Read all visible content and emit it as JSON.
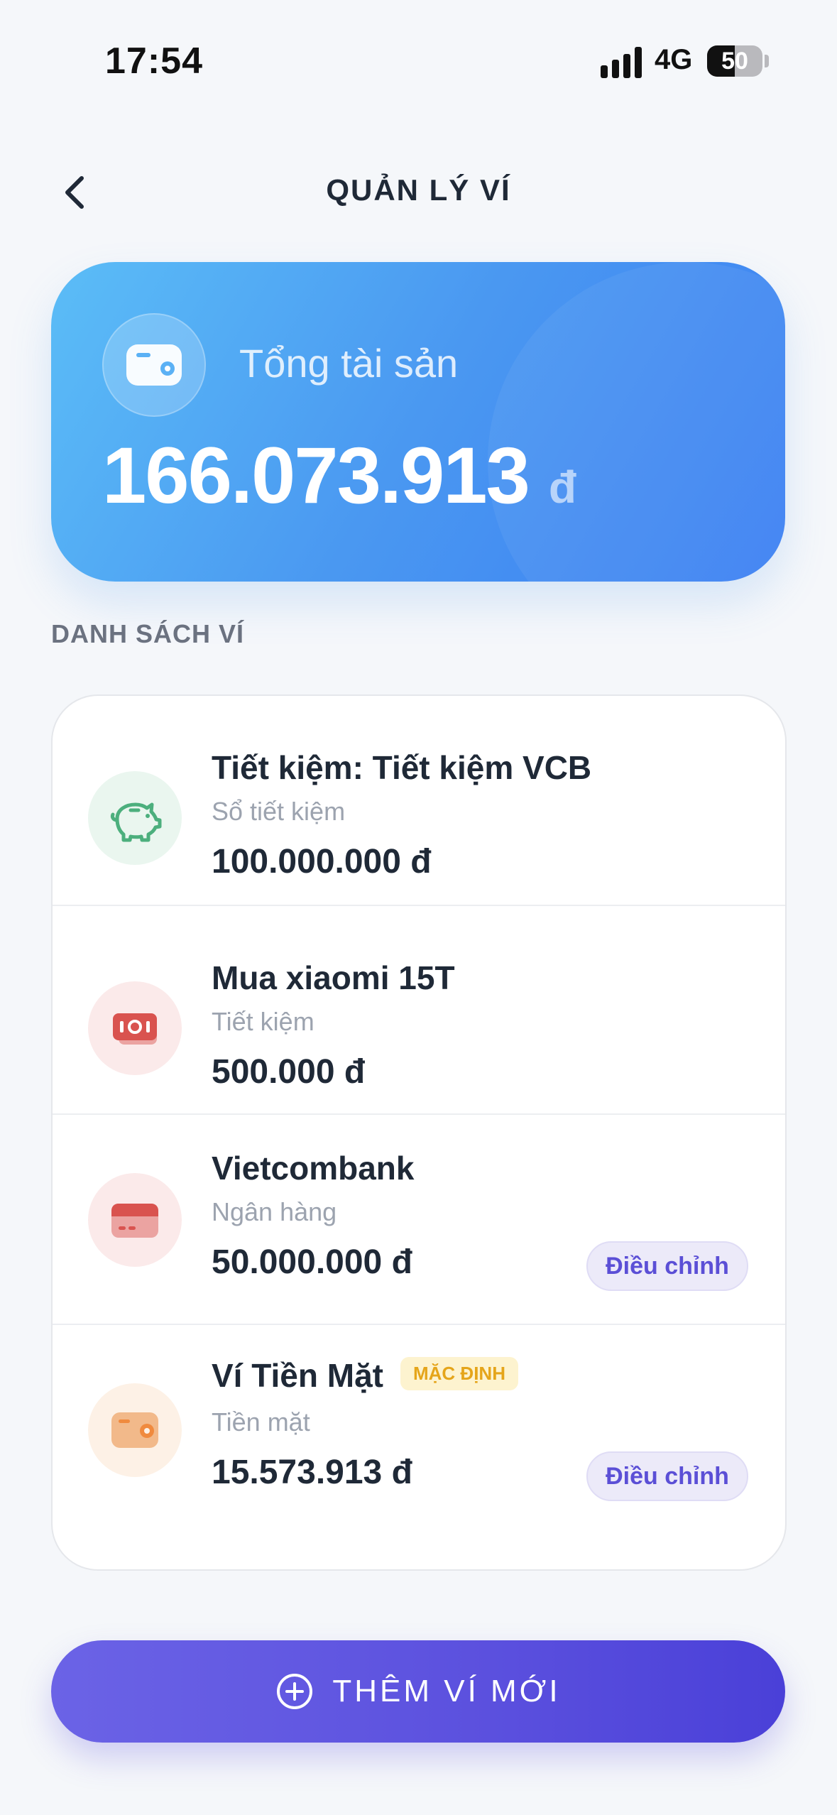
{
  "status_bar": {
    "time": "17:54",
    "network": "4G",
    "battery": "50"
  },
  "header": {
    "title": "QUẢN LÝ VÍ",
    "back_icon": "chevron-left-icon"
  },
  "total": {
    "label": "Tổng tài sản",
    "value": "166.073.913",
    "unit": "đ",
    "icon": "wallet-icon"
  },
  "section_label": "DANH SÁCH VÍ",
  "wallets": [
    {
      "name": "Tiết kiệm: Tiết kiệm VCB",
      "type": "Sổ tiết kiệm",
      "amount": "100.000.000 đ",
      "icon": "piggy-bank-icon",
      "icon_bg": "#eaf6ef",
      "icon_color": "#4caf7d"
    },
    {
      "name": "Mua xiaomi 15T",
      "type": "Tiết kiệm",
      "amount": "500.000 đ",
      "icon": "cash-icon",
      "icon_bg": "#fbeaea",
      "icon_color": "#d9534f"
    },
    {
      "name": "Vietcombank",
      "type": "Ngân hàng",
      "amount": "50.000.000 đ",
      "icon": "bank-card-icon",
      "icon_bg": "#fbeaea",
      "icon_color": "#d9534f",
      "action": "Điều chỉnh"
    },
    {
      "name": "Ví Tiền Mặt",
      "badge": "MẶC ĐỊNH",
      "type": "Tiền mặt",
      "amount": "15.573.913 đ",
      "icon": "wallet-icon",
      "icon_bg": "#fdf1e6",
      "icon_color": "#f08a3e",
      "action": "Điều chỉnh"
    }
  ],
  "add_button": {
    "label": "THÊM VÍ MỚI",
    "icon": "plus-circle-icon"
  },
  "colors": {
    "accent": "#5b50de",
    "card_blue": "#4a98f1",
    "badge_text": "#e5a51a"
  }
}
